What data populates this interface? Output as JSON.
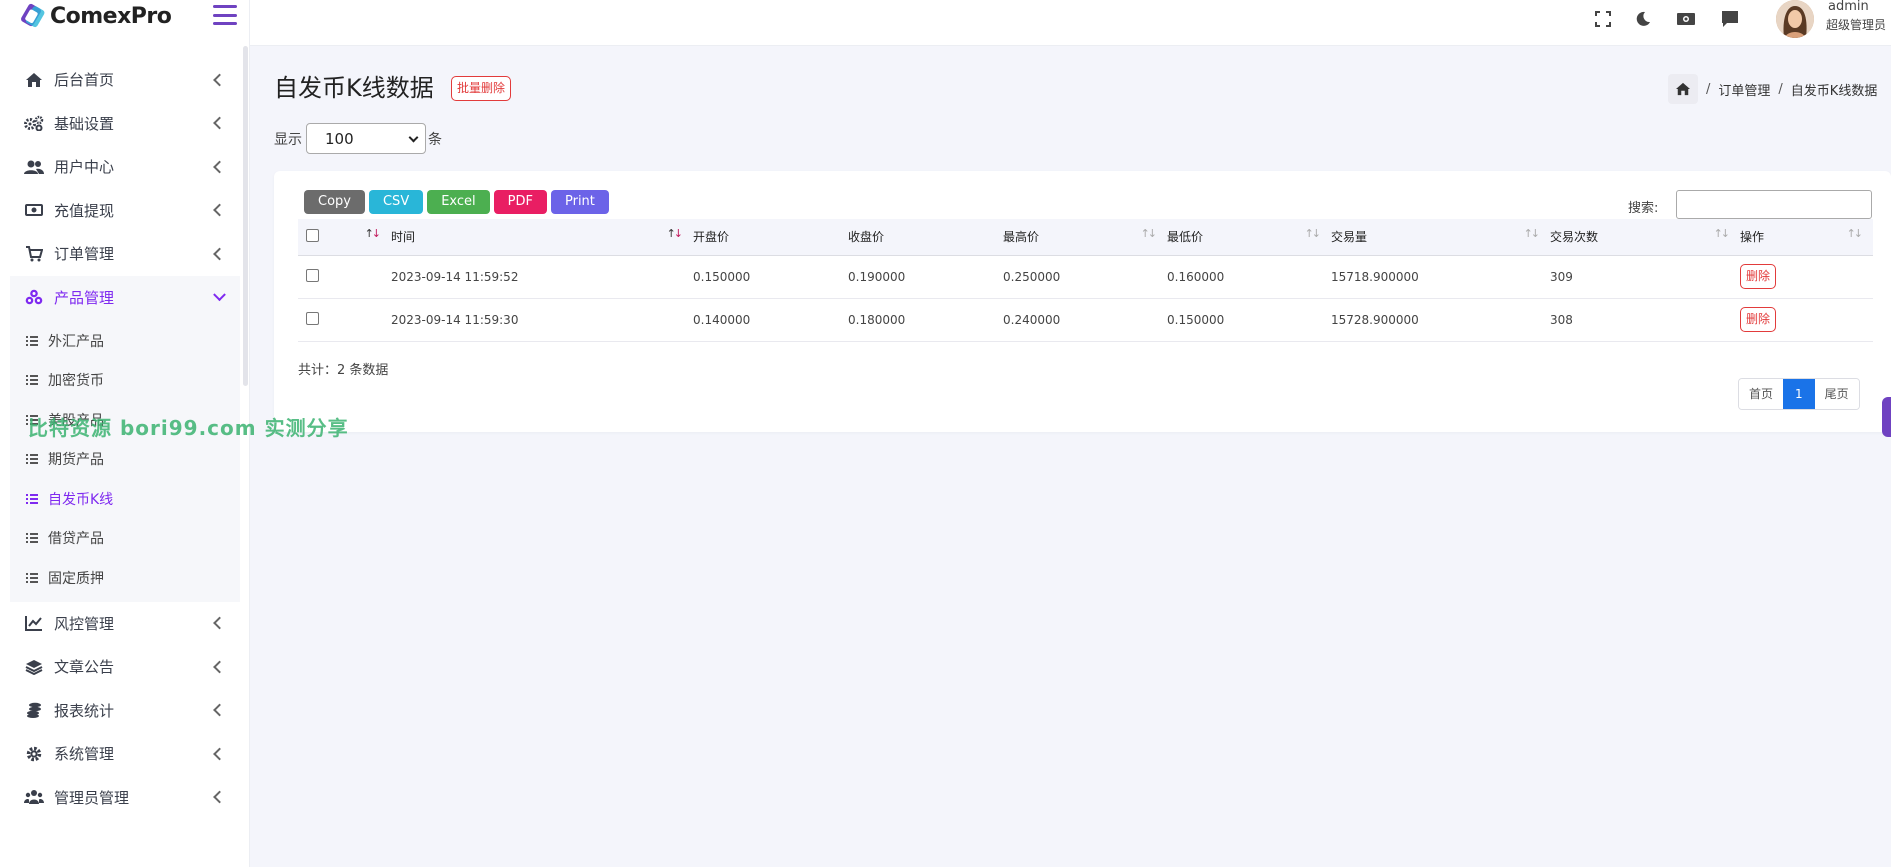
{
  "brand": {
    "name": "ComexPro"
  },
  "sidebar": {
    "items": [
      {
        "label": "后台首页",
        "icon": "home-icon"
      },
      {
        "label": "基础设置",
        "icon": "gears-icon"
      },
      {
        "label": "用户中心",
        "icon": "users-icon"
      },
      {
        "label": "充值提现",
        "icon": "money-icon"
      },
      {
        "label": "订单管理",
        "icon": "cart-icon"
      },
      {
        "label": "产品管理",
        "icon": "cubes-icon",
        "open": true
      }
    ],
    "sub_items": [
      {
        "label": "外汇产品"
      },
      {
        "label": "加密货币"
      },
      {
        "label": "美股产品"
      },
      {
        "label": "期货产品"
      },
      {
        "label": "自发币K线",
        "active": true
      },
      {
        "label": "借贷产品"
      },
      {
        "label": "固定质押"
      }
    ],
    "items_after": [
      {
        "label": "风控管理",
        "icon": "chart-line-icon"
      },
      {
        "label": "文章公告",
        "icon": "layers-icon"
      },
      {
        "label": "报表统计",
        "icon": "coins-icon"
      },
      {
        "label": "系统管理",
        "icon": "gear-icon"
      },
      {
        "label": "管理员管理",
        "icon": "user-group-icon"
      }
    ]
  },
  "topbar": {
    "user_name": "admin",
    "user_role": "超级管理员"
  },
  "page": {
    "title": "自发币K线数据",
    "batch_delete": "批量删除",
    "breadcrumb": [
      "订单管理",
      "自发币K线数据"
    ],
    "show_prefix": "显示",
    "show_value": "100",
    "show_suffix": "条"
  },
  "toolbar": {
    "buttons": [
      {
        "label": "Copy",
        "color": "#6c6c6c"
      },
      {
        "label": "CSV",
        "color": "#29b6d8"
      },
      {
        "label": "Excel",
        "color": "#4caf50"
      },
      {
        "label": "PDF",
        "color": "#e91e63"
      },
      {
        "label": "Print",
        "color": "#6c63e8"
      }
    ],
    "search_label": "搜索:"
  },
  "table": {
    "headers": [
      "时间",
      "开盘价",
      "收盘价",
      "最高价",
      "最低价",
      "交易量",
      "交易次数",
      "操作"
    ],
    "rows": [
      [
        "2023-09-14 11:59:52",
        "0.150000",
        "0.190000",
        "0.250000",
        "0.160000",
        "15718.900000",
        "309",
        "删除"
      ],
      [
        "2023-09-14 11:59:30",
        "0.140000",
        "0.180000",
        "0.240000",
        "0.150000",
        "15728.900000",
        "308",
        "删除"
      ]
    ],
    "total": "共计：2 条数据"
  },
  "pagination": {
    "first": "首页",
    "current": "1",
    "last": "尾页"
  },
  "watermark": "比特资源 bori99.com 实测分享",
  "colors": {
    "accent": "#7f2af0",
    "danger": "#e23b3b",
    "primary": "#1a73e8"
  }
}
